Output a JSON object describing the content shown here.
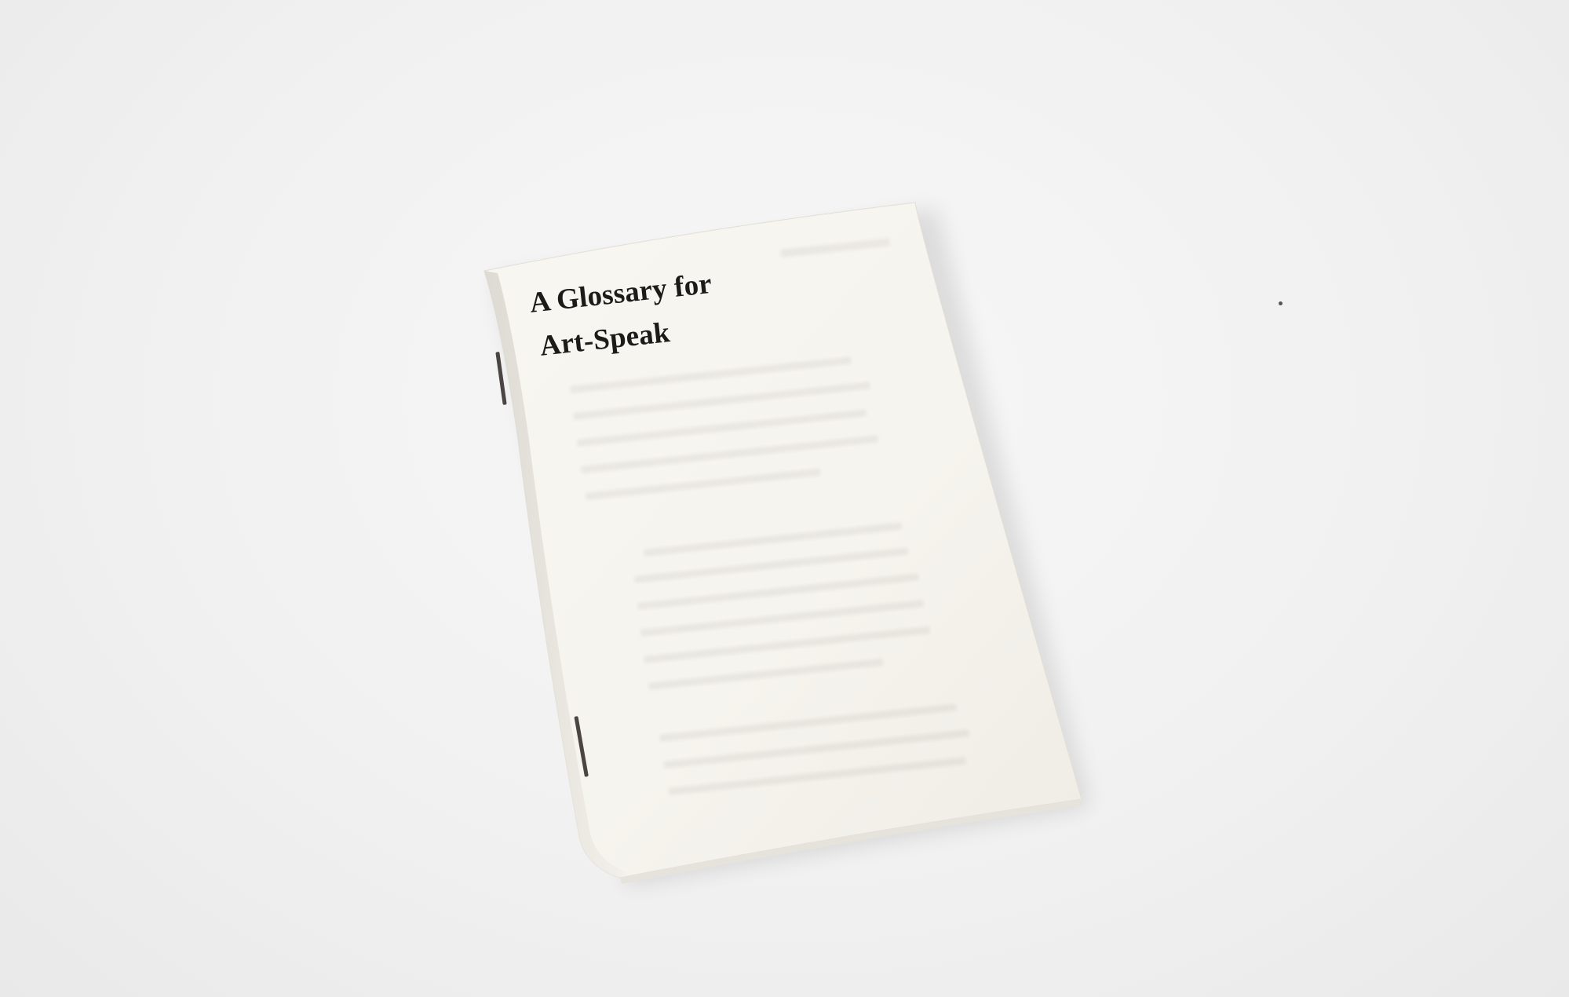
{
  "scene": {
    "background_color": "#f1f1f1",
    "object": "stapled booklet"
  },
  "booklet": {
    "cover_color": "#f7f5ef",
    "title_lines": [
      "A Glossary for",
      "Art-Speak"
    ]
  }
}
